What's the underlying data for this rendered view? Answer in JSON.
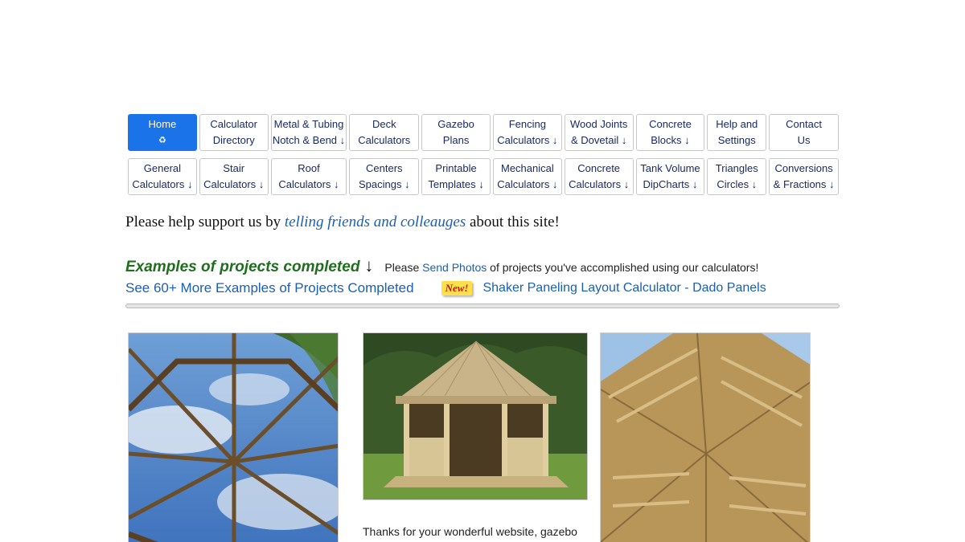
{
  "nav_row_1": [
    {
      "line1": "Home",
      "line2": "♻",
      "active": true
    },
    {
      "line1": "Calculator",
      "line2": "Directory"
    },
    {
      "line1": "Metal & Tubing",
      "line2": "Notch & Bend ↓"
    },
    {
      "line1": "Deck",
      "line2": "Calculators"
    },
    {
      "line1": "Gazebo",
      "line2": "Plans"
    },
    {
      "line1": "Fencing",
      "line2": "Calculators ↓"
    },
    {
      "line1": "Wood Joints",
      "line2": "& Dovetail ↓"
    },
    {
      "line1": "Concrete",
      "line2": "Blocks ↓"
    },
    {
      "line1": "Help and",
      "line2": "Settings"
    },
    {
      "line1": "Contact",
      "line2": "Us"
    }
  ],
  "nav_row_2": [
    {
      "line1": "General",
      "line2": "Calculators ↓"
    },
    {
      "line1": "Stair",
      "line2": "Calculators ↓"
    },
    {
      "line1": "Roof",
      "line2": "Calculators ↓"
    },
    {
      "line1": "Centers",
      "line2": "Spacings ↓"
    },
    {
      "line1": "Printable",
      "line2": "Templates ↓"
    },
    {
      "line1": "Mechanical",
      "line2": "Calculators ↓"
    },
    {
      "line1": "Concrete",
      "line2": "Calculators ↓"
    },
    {
      "line1": "Tank Volume",
      "line2": "DipCharts ↓"
    },
    {
      "line1": "Triangles",
      "line2": "Circles ↓"
    },
    {
      "line1": "Conversions",
      "line2": "& Fractions ↓"
    }
  ],
  "support": {
    "prefix": "Please help support us by ",
    "link": "telling friends and colleauges",
    "suffix": " about this site!"
  },
  "examples": {
    "title": "Examples of projects completed",
    "arrow": "↓",
    "please_prefix": "Please ",
    "send_photos": "Send Photos",
    "please_suffix": " of projects you've accomplished using our calculators!"
  },
  "more": {
    "link": "See 60+ More Examples of Projects Completed",
    "badge": "New!",
    "shaker": "Shaker Paneling Layout Calculator - Dado Panels"
  },
  "caption": "Thanks for your wonderful website, gazebo",
  "colors": {
    "active_nav": "#1a73e8",
    "link": "#1a5fb4",
    "examples_title": "#1e6e1e",
    "badge_bg": "#ffe04a",
    "badge_text": "#c01818"
  }
}
